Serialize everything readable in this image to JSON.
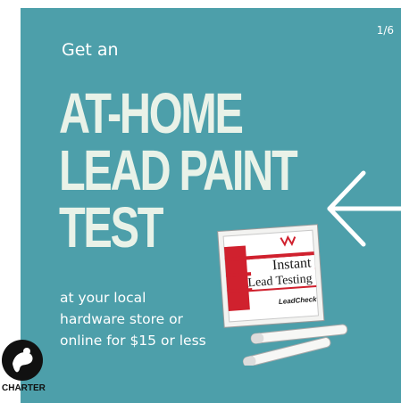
{
  "slide": {
    "counter": "1/6",
    "intro": "Get an",
    "headline": [
      "AT-HOME",
      "LEAD PAINT",
      "TEST"
    ],
    "body": [
      "at your local",
      "hardware store or",
      "online for $15 or less"
    ]
  },
  "product": {
    "brand": "Instant",
    "name": "Lead Testing",
    "badge": "LeadCheck"
  },
  "logo": {
    "text": "CHARTER"
  },
  "colors": {
    "background": "#4d9faa",
    "headline": "#e9f2e8",
    "text": "#ffffff",
    "accent_red": "#d0212e"
  },
  "icons": {
    "arrow": "arrow-left-icon",
    "logo": "charter-logo-icon"
  }
}
